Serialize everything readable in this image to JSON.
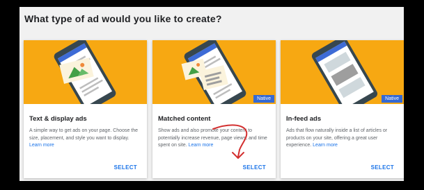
{
  "page": {
    "heading": "What type of ad would you like to create?"
  },
  "cards": [
    {
      "title": "Text & display ads",
      "desc": "A simple way to get ads on your page. Choose the size, placement, and style you want to display.",
      "learn_more": "Learn more",
      "select": "SELECT",
      "badge": ""
    },
    {
      "title": "Matched content",
      "desc": "Show ads and also promote your content to potentially increase revenue, page views, and time spent on site.",
      "learn_more": "Learn more",
      "select": "SELECT",
      "badge": "Native"
    },
    {
      "title": "In-feed ads",
      "desc": "Ads that flow naturally inside a list of articles or products on your site, offering a great user experience.",
      "learn_more": "Learn more",
      "select": "SELECT",
      "badge": "Native"
    }
  ],
  "colors": {
    "hero": "#f7a812",
    "badge": "#3569d2",
    "link": "#1a73e8",
    "annotation_arrow": "#d32f2f"
  },
  "icons": [
    "phone-illustration-icon",
    "annotation-arrow-icon"
  ]
}
